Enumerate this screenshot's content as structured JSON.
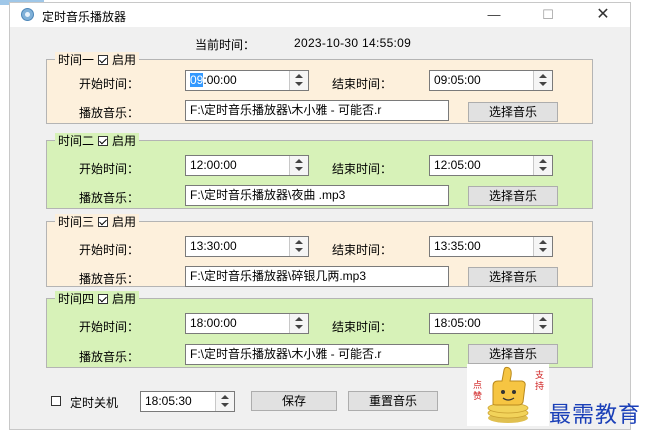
{
  "window": {
    "title": "定时音乐播放器",
    "minimize": "—",
    "maximize": "☐",
    "close": "✕"
  },
  "current_time": {
    "label": "当前时间：",
    "value": "2023-10-30 14:55:09"
  },
  "labels": {
    "start": "开始时间：",
    "end": "结束时间：",
    "music": "播放音乐：",
    "enable": "启用",
    "choose": "选择音乐"
  },
  "slots": [
    {
      "name": "时间一",
      "enabled": true,
      "start_sel": "09",
      "start_rest": ":00:00",
      "end": "09:05:00",
      "path": "F:\\定时音乐播放器\\木小雅 - 可能否.r"
    },
    {
      "name": "时间二",
      "enabled": true,
      "start_sel": "",
      "start_rest": "12:00:00",
      "end": "12:05:00",
      "path": "F:\\定时音乐播放器\\夜曲 .mp3"
    },
    {
      "name": "时间三",
      "enabled": true,
      "start_sel": "",
      "start_rest": "13:30:00",
      "end": "13:35:00",
      "path": "F:\\定时音乐播放器\\碎银几两.mp3"
    },
    {
      "name": "时间四",
      "enabled": true,
      "start_sel": "",
      "start_rest": "18:00:00",
      "end": "18:05:00",
      "path": "F:\\定时音乐播放器\\木小雅 - 可能否.r"
    }
  ],
  "bottom": {
    "shutdown_label": "定时关机",
    "shutdown_enabled": false,
    "shutdown_time": "18:05:30",
    "save": "保存",
    "reset": "重置音乐"
  },
  "sticker": {
    "left_text": "点赞",
    "right_text": "支持"
  },
  "watermark": "最需教育",
  "colors": {
    "slot_odd": "#fdf0dc",
    "slot_even": "#d7f2b8",
    "selection": "#3399ff",
    "watermark": "#1a3fb8"
  }
}
